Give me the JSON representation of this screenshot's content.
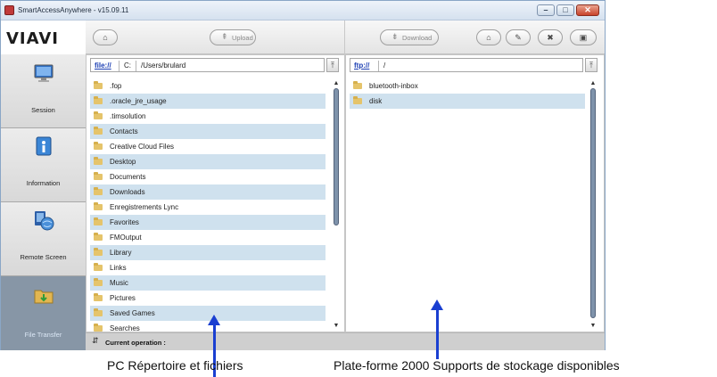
{
  "window": {
    "title": "SmartAccessAnywhere - v15.09.11",
    "controls": [
      "minimize-icon",
      "maximize-icon",
      "close-icon"
    ]
  },
  "brand": {
    "logo_text": "VIAVI"
  },
  "sidebar": {
    "items": [
      {
        "label": "Session",
        "icon": "monitor-icon"
      },
      {
        "label": "Information",
        "icon": "info-icon"
      },
      {
        "label": "Remote Screen",
        "icon": "remote-screen-icon"
      },
      {
        "label": "File Transfer",
        "icon": "file-transfer-icon",
        "active": true
      }
    ]
  },
  "toolbar": {
    "left_home_icon": "home-icon",
    "upload_label": "Upload",
    "download_label": "Download",
    "right_icons": [
      "home-icon",
      "edit-icon",
      "delete-icon",
      "new-folder-icon"
    ]
  },
  "local": {
    "scheme": "file://",
    "drive": "C:",
    "path": "/Users/brulard",
    "files": [
      ".fop",
      ".oracle_jre_usage",
      ".timsolution",
      "Contacts",
      "Creative Cloud Files",
      "Desktop",
      "Documents",
      "Downloads",
      "Enregistrements Lync",
      "Favorites",
      "FMOutput",
      "Library",
      "Links",
      "Music",
      "Pictures",
      "Saved Games",
      "Searches"
    ]
  },
  "remote": {
    "scheme": "ftp://",
    "path": "/",
    "files": [
      "bluetooth-inbox",
      "disk"
    ]
  },
  "status": {
    "label": "Current operation :"
  },
  "annotations": {
    "left_caption": "PC Répertoire et fichiers",
    "right_caption": "Plate-forme 2000 Supports de stockage disponibles"
  },
  "colors": {
    "accent_annotation": "#1a3fd1",
    "row_highlight": "#cfe1ee",
    "active_nav": "#8796a6"
  }
}
